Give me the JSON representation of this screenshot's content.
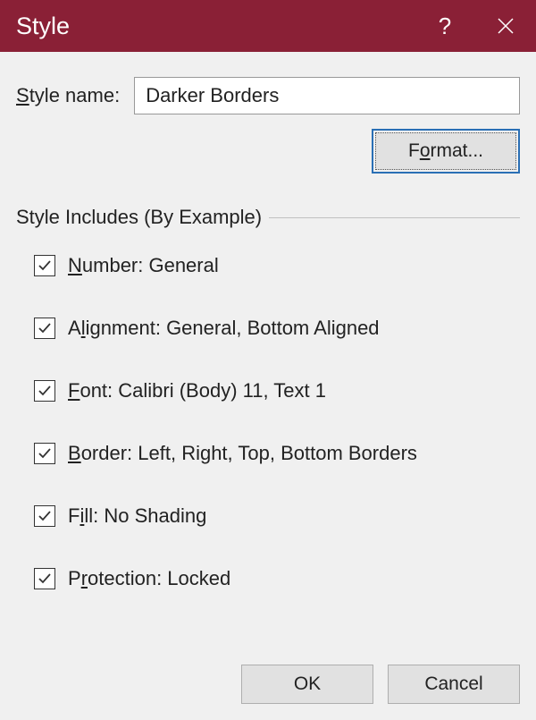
{
  "titlebar": {
    "title": "Style"
  },
  "form": {
    "name_label_pre": "",
    "name_label_u": "S",
    "name_label_post": "tyle name:",
    "name_value": "Darker Borders",
    "format_pre": "F",
    "format_u": "o",
    "format_post": "rmat..."
  },
  "group": {
    "label": "Style Includes (By Example)"
  },
  "checks": [
    {
      "pre": "",
      "u": "N",
      "post": "umber: General",
      "checked": true
    },
    {
      "pre": "A",
      "u": "l",
      "post": "ignment: General, Bottom Aligned",
      "checked": true
    },
    {
      "pre": "",
      "u": "F",
      "post": "ont: Calibri (Body) 11, Text 1",
      "checked": true
    },
    {
      "pre": "",
      "u": "B",
      "post": "order: Left, Right, Top, Bottom Borders",
      "checked": true
    },
    {
      "pre": "F",
      "u": "i",
      "post": "ll: No Shading",
      "checked": true
    },
    {
      "pre": "P",
      "u": "r",
      "post": "otection: Locked",
      "checked": true
    }
  ],
  "footer": {
    "ok": "OK",
    "cancel": "Cancel"
  }
}
